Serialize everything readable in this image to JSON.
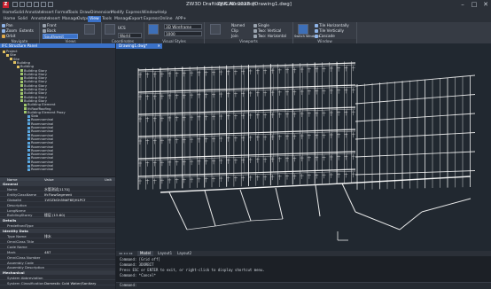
{
  "window": {
    "app_title": "ZW3D Drafting & Annotation",
    "app_name": "ZWCAD 2022",
    "document": "[Drawing1.dwg]",
    "logo": "Z",
    "controls": {
      "minimize": "–",
      "maximize": "□",
      "close": "✕"
    }
  },
  "menu": [
    "Home",
    "Solid",
    "Annotate",
    "Insert",
    "Format",
    "Tools",
    "Draw",
    "Dimension",
    "Modify",
    "Express",
    "Window",
    "Help"
  ],
  "ribbon_tabs": [
    "Home",
    "Solid",
    "Annotate",
    "Insert",
    "Manage",
    "Output",
    "View",
    "Tools",
    "Manage",
    "Export",
    "Express",
    "Online",
    "APP+"
  ],
  "ribbon_active": "View",
  "ribbon": {
    "navigate": {
      "label": "Navigate",
      "pan": "Pan",
      "zoom": "Zoom",
      "extents": "Extents",
      "orbit": "Orbit"
    },
    "views": {
      "label": "Views",
      "front": "Front",
      "back": "Back",
      "southwest": "Southwest"
    },
    "coordinates": {
      "label": "Coordinates",
      "ucs": "UCS",
      "world": "World"
    },
    "visual_styles": {
      "label": "Visual Styles",
      "style": "3D Wireframe",
      "value": "1000"
    },
    "viewports": {
      "label": "Viewports",
      "named": "Named",
      "clip": "Clip",
      "join": "Join",
      "single": "Single",
      "two_vertical": "Two: Vertical",
      "two_horizontal": "Two: Horizontal"
    },
    "window": {
      "label": "Window",
      "switch_windows": "Switch Windows",
      "tile_h": "Tile Horizontally",
      "tile_v": "Tile Vertically",
      "cascade": "Cascade"
    }
  },
  "structure_panel": {
    "title": "IFC Structure Panel",
    "tree": [
      {
        "level": 0,
        "label": "Project"
      },
      {
        "level": 1,
        "label": "Site"
      },
      {
        "level": 2,
        "label": "Site"
      },
      {
        "level": 3,
        "label": "Building"
      },
      {
        "level": 4,
        "label": "Building"
      },
      {
        "level": 5,
        "label": "Building Story"
      },
      {
        "level": 5,
        "label": "Building Story"
      },
      {
        "level": 5,
        "label": "Building Story"
      },
      {
        "level": 5,
        "label": "Building Story"
      },
      {
        "level": 5,
        "label": "Building Story"
      },
      {
        "level": 5,
        "label": "Building Story"
      },
      {
        "level": 5,
        "label": "Building Story"
      },
      {
        "level": 5,
        "label": "Building Story"
      },
      {
        "level": 5,
        "label": "Building Story"
      },
      {
        "level": 6,
        "label": "Building Element"
      },
      {
        "level": 6,
        "label": "IfcRoofRoofing"
      },
      {
        "level": 6,
        "label": "Building Element Proxy"
      },
      {
        "level": 7,
        "label": "Slab"
      },
      {
        "level": 7,
        "label": "Roomnominal"
      },
      {
        "level": 7,
        "label": "Roomnominal"
      },
      {
        "level": 7,
        "label": "Roomnominal"
      },
      {
        "level": 7,
        "label": "Roomnominal"
      },
      {
        "level": 7,
        "label": "Roomnominal"
      },
      {
        "level": 7,
        "label": "Roomnominal"
      },
      {
        "level": 7,
        "label": "Roomnominal"
      },
      {
        "level": 7,
        "label": "Roomnominal"
      },
      {
        "level": 7,
        "label": "Roomnominal"
      },
      {
        "level": 7,
        "label": "Roomnominal"
      },
      {
        "level": 7,
        "label": "Roomnominal"
      },
      {
        "level": 7,
        "label": "Roomnominal"
      },
      {
        "level": 7,
        "label": "Roomnominal"
      },
      {
        "level": 7,
        "label": "Roomnominal"
      }
    ]
  },
  "properties": {
    "header": {
      "name": "Name",
      "value": "Value",
      "unit": "Unit"
    },
    "rows": [
      {
        "type": "section",
        "key": "General"
      },
      {
        "key": "Name",
        "value": "水管测试[1170]"
      },
      {
        "key": "EntityClassName",
        "value": "IfcFlowSegment"
      },
      {
        "key": "GlobalId",
        "value": "1VOZkGh5NdF6EjHLPCf"
      },
      {
        "key": "Description",
        "value": ""
      },
      {
        "key": "LongName",
        "value": ""
      },
      {
        "key": "BuildingStorey",
        "value": "楼层 (15.60)"
      },
      {
        "type": "section",
        "key": "Details"
      },
      {
        "key": "PredefinedType",
        "value": ""
      },
      {
        "type": "section",
        "key": "Identity Data"
      },
      {
        "key": "Type Name",
        "value": "排水"
      },
      {
        "key": "OmniClass Title",
        "value": ""
      },
      {
        "key": "Code Name",
        "value": ""
      },
      {
        "key": "Mark",
        "value": "487"
      },
      {
        "key": "OmniClass Number",
        "value": ""
      },
      {
        "key": "Assembly Code",
        "value": ""
      },
      {
        "key": "Assembly Description",
        "value": ""
      },
      {
        "type": "section",
        "key": "Mechanical"
      },
      {
        "key": "System Abbreviation",
        "value": ""
      },
      {
        "key": "System Classification",
        "value": "Domestic Cold Water/Sanitary"
      }
    ]
  },
  "viewport": {
    "tab": "Drawing1.dwg*",
    "close": "✕"
  },
  "layout_tabs": [
    "Model",
    "Layout1",
    "Layout2"
  ],
  "command": {
    "lines": [
      "Command: [Grid off]",
      "Command: 3DORBIT",
      "Press ESC or ENTER to exit, or right-click to display shortcut menu.",
      "Command: *Cancel*"
    ],
    "prompt": "Command:"
  },
  "colors": {
    "accent": "#3a71c8",
    "background": "#212830",
    "wire": "#ffffff"
  }
}
